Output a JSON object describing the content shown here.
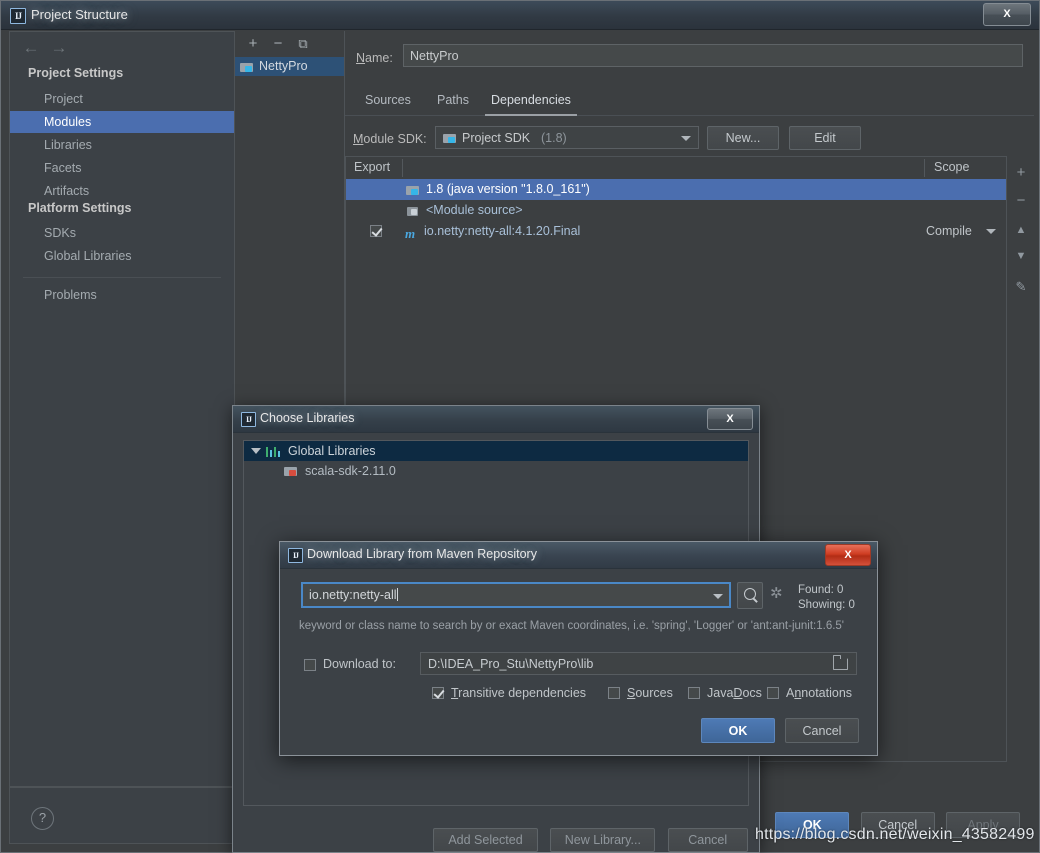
{
  "window": {
    "title": "Project Structure",
    "close_label": "X",
    "app_icon": "IJ"
  },
  "sidebar": {
    "nav_back_icon": "←",
    "nav_forward_icon": "→",
    "groups": [
      {
        "label": "Project Settings",
        "items": [
          "Project",
          "Modules",
          "Libraries",
          "Facets",
          "Artifacts"
        ]
      },
      {
        "label": "Platform Settings",
        "items": [
          "SDKs",
          "Global Libraries"
        ]
      }
    ],
    "extra_items": [
      "Problems"
    ],
    "selected": "Modules",
    "help_label": "?"
  },
  "module_panel": {
    "toolbar": {
      "add": "+",
      "remove": "−",
      "copy": "⧉"
    },
    "items": [
      {
        "label": "NettyPro",
        "selected": true
      }
    ]
  },
  "detail": {
    "name_label": "Name:",
    "name_value": "NettyPro",
    "tabs": [
      {
        "label": "Sources",
        "active": false
      },
      {
        "label": "Paths",
        "active": false
      },
      {
        "label": "Dependencies",
        "active": true
      }
    ],
    "module_sdk_label": "Module SDK:",
    "module_sdk_value": "Project SDK",
    "module_sdk_suffix": "(1.8)",
    "new_button": "New...",
    "edit_button": "Edit",
    "table": {
      "columns": [
        "Export",
        "",
        "Scope"
      ],
      "rows": [
        {
          "export": null,
          "icon": "folder-java-icon",
          "name": "1.8 (java version \"1.8.0_161\")",
          "scope": "",
          "selected": true
        },
        {
          "export": null,
          "icon": "module-source-icon",
          "name": "<Module source>",
          "scope": "",
          "selected": false
        },
        {
          "export": true,
          "icon": "maven-icon",
          "name": "io.netty:netty-all:4.1.20.Final",
          "scope": "Compile",
          "selected": false
        }
      ]
    },
    "side_tools": [
      "+",
      "−",
      "▲",
      "▼",
      "✎"
    ]
  },
  "footer": {
    "ok": "OK",
    "cancel": "Cancel",
    "apply": "Apply"
  },
  "choose_libraries_dialog": {
    "title": "Choose Libraries",
    "app_icon": "IJ",
    "close_label": "X",
    "tree": [
      {
        "label": "Global Libraries",
        "icon": "library-bars-icon",
        "level": 0,
        "expanded": true,
        "selected": true
      },
      {
        "label": "scala-sdk-2.11.0",
        "icon": "folder-scala-icon",
        "level": 1,
        "expanded": false,
        "selected": false
      }
    ],
    "buttons": [
      "Add Selected",
      "New Library...",
      "Cancel"
    ]
  },
  "maven_dialog": {
    "title": "Download Library from Maven Repository",
    "app_icon": "IJ",
    "close_label": "X",
    "search_value": "io.netty:netty-all",
    "search_icon": "search-icon",
    "dropdown_icon": "chevron-down-icon",
    "loading_icon": "spinner-icon",
    "found_label": "Found: 0",
    "showing_label": "Showing: 0",
    "hint": "keyword or class name to search by or exact Maven coordinates, i.e. 'spring', 'Logger' or 'ant:ant-junit:1.6.5'",
    "download_to_label": "Download to:",
    "download_to_checked": false,
    "download_path": "D:\\IDEA_Pro_Stu\\NettyPro\\lib",
    "folder_icon": "folder-browse-icon",
    "options": [
      {
        "label": "Transitive dependencies",
        "checked": true
      },
      {
        "label": "Sources",
        "checked": false
      },
      {
        "label": "JavaDocs",
        "checked": false
      },
      {
        "label": "Annotations",
        "checked": false
      }
    ],
    "ok": "OK",
    "cancel": "Cancel"
  },
  "watermark": "https://blog.csdn.net/weixin_43582499",
  "colors": {
    "selection_blue": "#4b6eaf",
    "tree_selection": "#0d2a42",
    "accent_focus": "#4a88c7",
    "window_bg": "#3c3f41",
    "panel_bg": "#3c4146",
    "link_text": "#a9c0d8"
  }
}
